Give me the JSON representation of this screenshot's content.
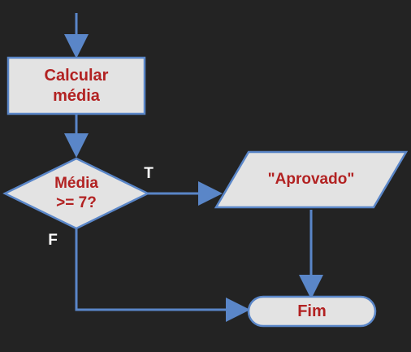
{
  "diagram": {
    "process_label": "Calcular\nmédia",
    "decision_label": "Média\n>= 7?",
    "true_label": "T",
    "false_label": "F",
    "output_label": "\"Aprovado\"",
    "terminal_label": "Fim"
  },
  "colors": {
    "background": "#232323",
    "shape_fill": "#e3e3e3",
    "shape_stroke": "#5a86c8",
    "arrow": "#5a86c8",
    "shape_text": "#b22222",
    "branch_text": "#ffffff"
  }
}
